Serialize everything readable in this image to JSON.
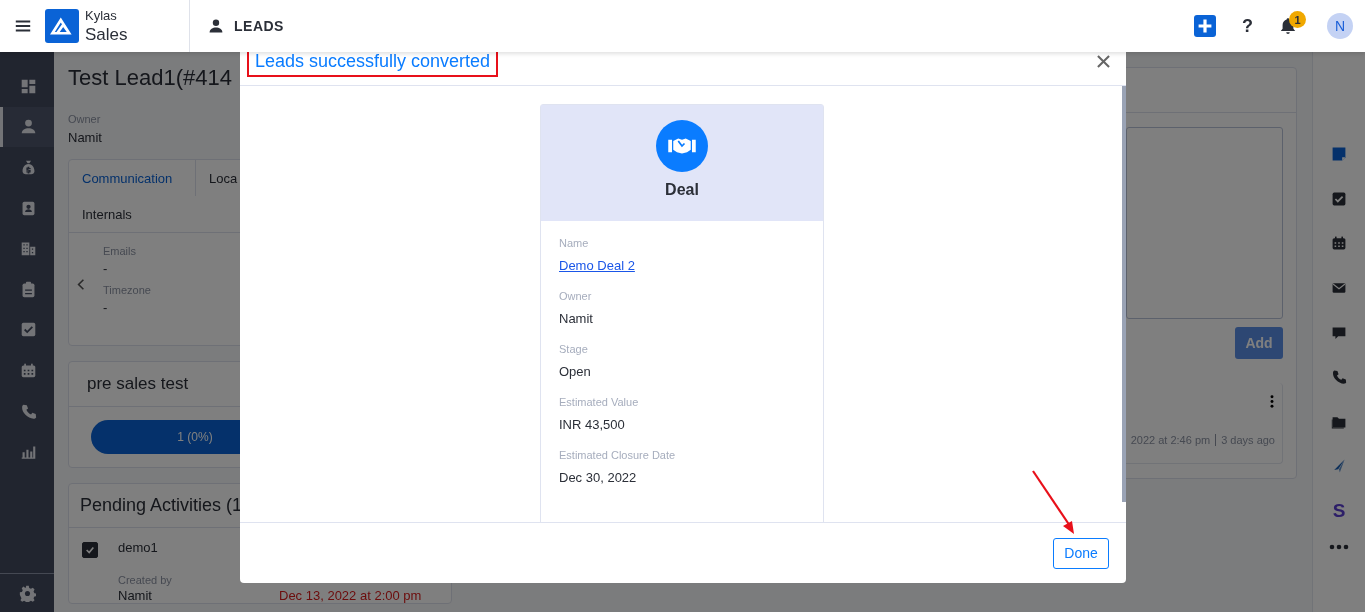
{
  "header": {
    "app_name": "Kylas",
    "product": "Sales",
    "section": "LEADS",
    "help": "?",
    "notification_count": "1",
    "avatar_initial": "N"
  },
  "left_nav": {
    "items": [
      {
        "kind": "dashboard",
        "selected": false
      },
      {
        "kind": "person",
        "selected": true
      },
      {
        "kind": "money-bag",
        "selected": false
      },
      {
        "kind": "contact-card",
        "selected": false
      },
      {
        "kind": "building",
        "selected": false
      },
      {
        "kind": "clipboard",
        "selected": false
      },
      {
        "kind": "checkbox",
        "selected": false
      },
      {
        "kind": "calendar",
        "selected": false
      },
      {
        "kind": "phone",
        "selected": false
      },
      {
        "kind": "chart",
        "selected": false
      }
    ]
  },
  "lead": {
    "title": "Test Lead1(#414",
    "owner_label": "Owner",
    "owner": "Namit",
    "tabs": [
      {
        "label": "Communication",
        "selected": true
      },
      {
        "label": "Loca",
        "selected": false
      },
      {
        "label": "Internals",
        "selected": false
      }
    ],
    "fields": [
      {
        "label": "Emails",
        "value": "-"
      },
      {
        "label": "Timezone",
        "value": "-"
      }
    ]
  },
  "pipeline": {
    "title": "pre sales test",
    "stage": "1 (0%)"
  },
  "pending": {
    "title": "Pending Activities (1",
    "items": [
      {
        "title": "demo1",
        "checked": true,
        "created_by_label": "Created by",
        "created_by": "Namit",
        "due": "Dec 13, 2022 at 2:00 pm"
      }
    ]
  },
  "notes": {
    "add_button": "Add",
    "note": {
      "timestamp": "2022 at 2:46 pm",
      "relative": "3 days ago"
    }
  },
  "right_rail": {
    "items": [
      {
        "kind": "note"
      },
      {
        "kind": "checkbox"
      },
      {
        "kind": "calendar"
      },
      {
        "kind": "envelope"
      },
      {
        "kind": "chat"
      },
      {
        "kind": "phone"
      },
      {
        "kind": "folder"
      },
      {
        "kind": "sail"
      },
      {
        "kind": "letter",
        "text": "S"
      },
      {
        "kind": "more"
      }
    ]
  },
  "modal": {
    "title": "Leads successfully converted",
    "card": {
      "title": "Deal",
      "fields": [
        {
          "label": "Name",
          "value": "Demo Deal 2",
          "kind": "link"
        },
        {
          "label": "Owner",
          "value": "Namit",
          "kind": "text"
        },
        {
          "label": "Stage",
          "value": "Open",
          "kind": "text"
        },
        {
          "label": "Estimated Value",
          "value": "INR 43,500",
          "kind": "text"
        },
        {
          "label": "Estimated Closure Date",
          "value": "Dec 30, 2022",
          "kind": "text"
        }
      ]
    },
    "done_button": "Done"
  }
}
